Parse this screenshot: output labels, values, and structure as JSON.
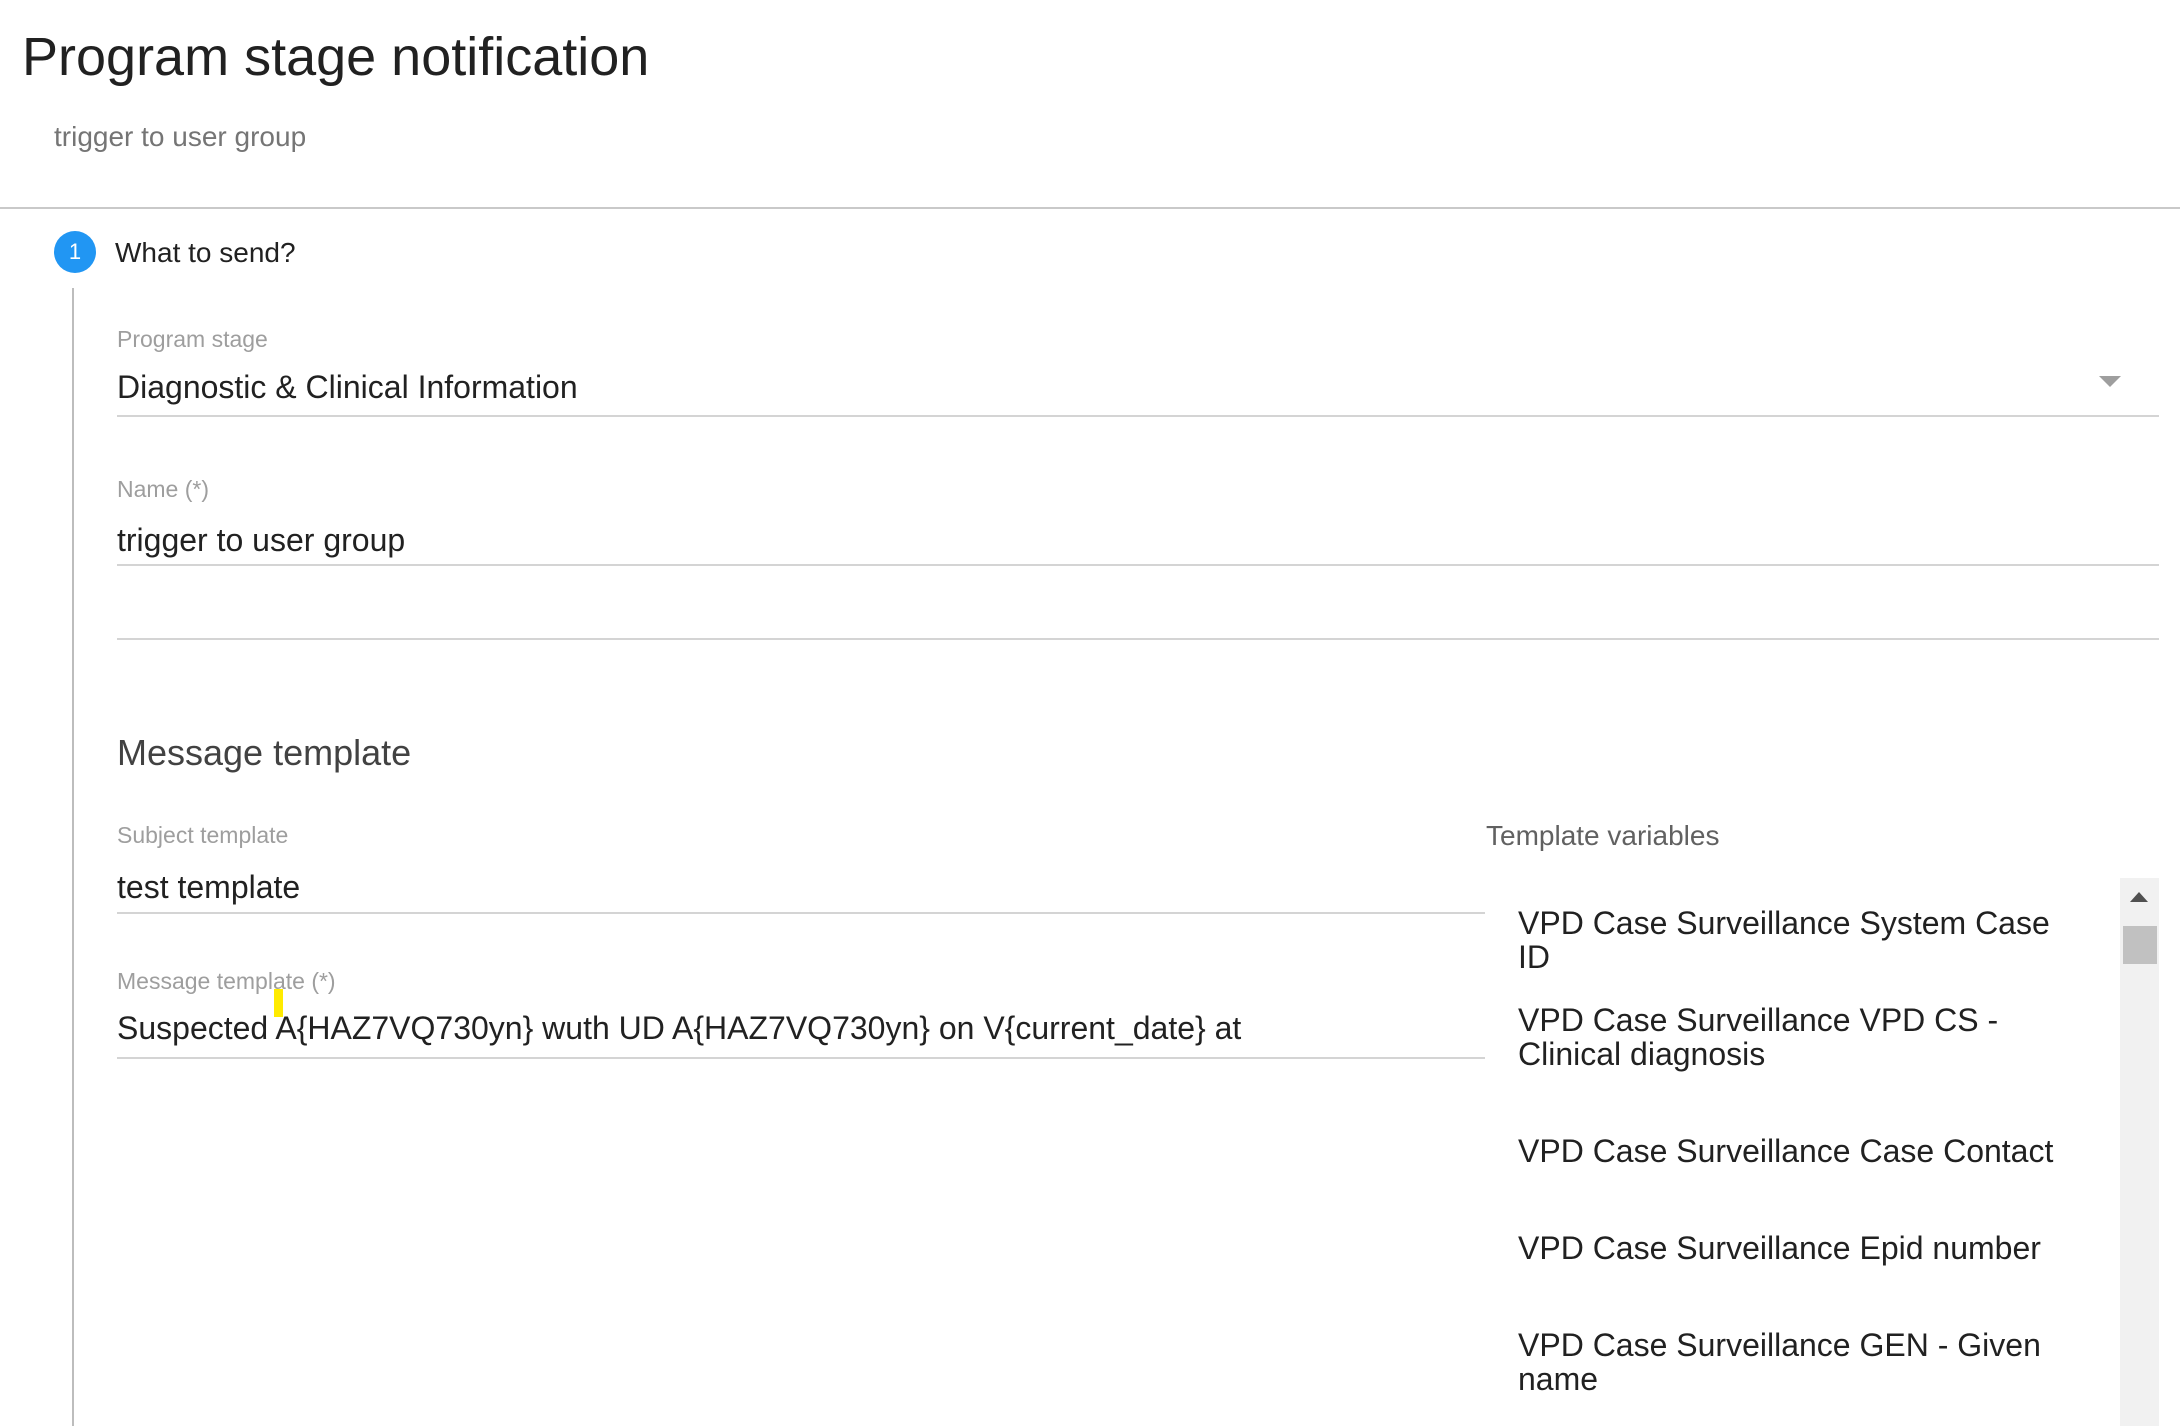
{
  "header": {
    "title": "Program stage notification",
    "subtitle": "trigger to user group"
  },
  "step": {
    "number": "1",
    "label": "What to send?"
  },
  "program_stage": {
    "label": "Program stage",
    "value": "Diagnostic & Clinical Information"
  },
  "name_field": {
    "label": "Name (*)",
    "value": "trigger to user group"
  },
  "message_template_section": {
    "heading": "Message template"
  },
  "subject_template": {
    "label": "Subject template",
    "value": "test template"
  },
  "message_template": {
    "label": "Message template (*)",
    "value": "Suspected A{HAZ7VQ730yn} wuth UD A{HAZ7VQ730yn} on V{current_date} at"
  },
  "template_variables": {
    "heading": "Template variables",
    "items": [
      "VPD Case Surveillance System Case ID",
      "VPD Case Surveillance VPD CS - Clinical diagnosis",
      "VPD Case Surveillance Case Contact",
      "VPD Case Surveillance Epid number",
      "VPD Case Surveillance GEN - Given name"
    ]
  },
  "colors": {
    "accent": "#2196f3",
    "cursor_highlight": "#ffeb00"
  },
  "icons": {
    "dropdown": "caret-down-icon",
    "scroll_up": "scroll-up-arrow-icon"
  }
}
